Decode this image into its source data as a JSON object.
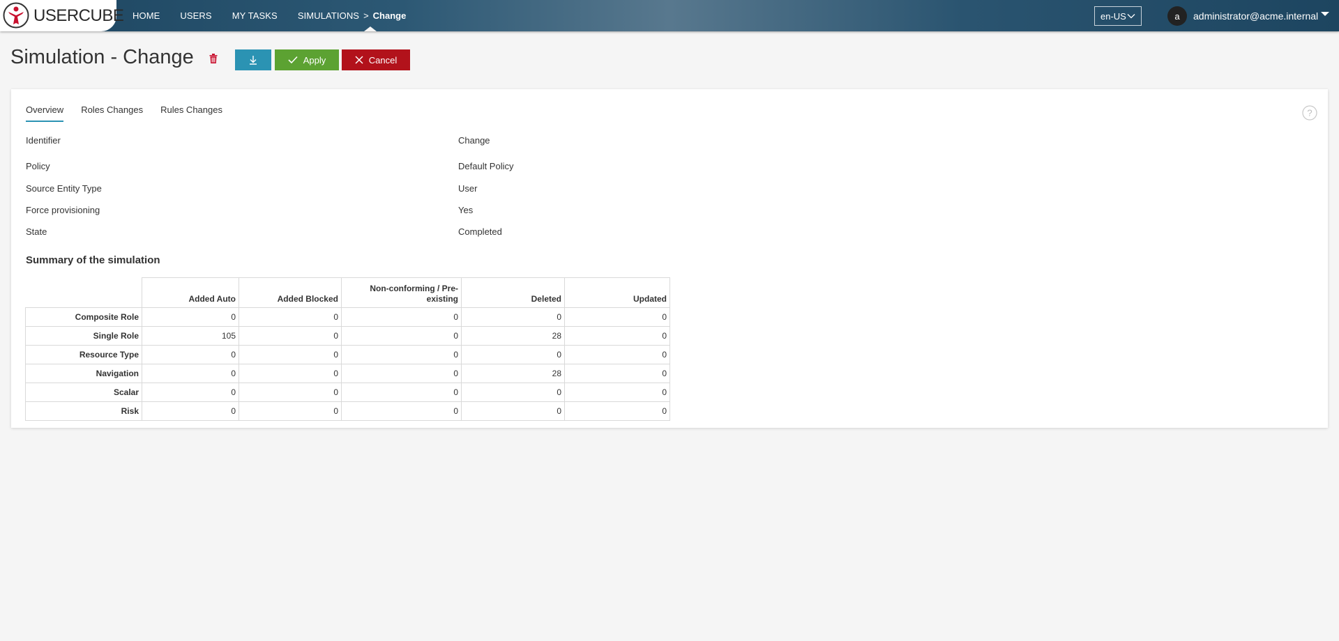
{
  "app": {
    "logo_text": "USERCUBE"
  },
  "nav": {
    "items": [
      "HOME",
      "USERS",
      "MY TASKS"
    ],
    "breadcrumb_parent": "SIMULATIONS",
    "breadcrumb_separator": ">",
    "breadcrumb_current": "Change"
  },
  "locale": {
    "selected": "en-US"
  },
  "user": {
    "avatar_letter": "a",
    "name": "administrator@acme.internal"
  },
  "page": {
    "title": "Simulation - Change",
    "apply_label": "Apply",
    "cancel_label": "Cancel"
  },
  "tabs": [
    "Overview",
    "Roles Changes",
    "Rules Changes"
  ],
  "overview": {
    "fields": [
      {
        "label": "Identifier",
        "value": "Change"
      },
      {
        "label": "Policy",
        "value": "Default Policy"
      },
      {
        "label": "Source Entity Type",
        "value": "User"
      },
      {
        "label": "Force provisioning",
        "value": "Yes"
      },
      {
        "label": "State",
        "value": "Completed"
      }
    ]
  },
  "summary": {
    "title": "Summary of the simulation",
    "columns": [
      "Added Auto",
      "Added Blocked",
      "Non-conforming / Pre-existing",
      "Deleted",
      "Updated"
    ],
    "rows": [
      {
        "label": "Composite Role",
        "values": [
          "0",
          "0",
          "0",
          "0",
          "0"
        ]
      },
      {
        "label": "Single Role",
        "values": [
          "105",
          "0",
          "0",
          "28",
          "0"
        ]
      },
      {
        "label": "Resource Type",
        "values": [
          "0",
          "0",
          "0",
          "0",
          "0"
        ]
      },
      {
        "label": "Navigation",
        "values": [
          "0",
          "0",
          "0",
          "28",
          "0"
        ]
      },
      {
        "label": "Scalar",
        "values": [
          "0",
          "0",
          "0",
          "0",
          "0"
        ]
      },
      {
        "label": "Risk",
        "values": [
          "0",
          "0",
          "0",
          "0",
          "0"
        ]
      }
    ]
  },
  "colors": {
    "download": "#2b93b3",
    "apply": "#5ca232",
    "cancel": "#b2121b",
    "brand_red": "#c8102e"
  },
  "icons": {
    "logo": "usercube-logo-icon",
    "download": "download-icon",
    "apply": "check-icon",
    "cancel": "close-icon",
    "delete": "trash-icon",
    "help": "help-icon"
  }
}
